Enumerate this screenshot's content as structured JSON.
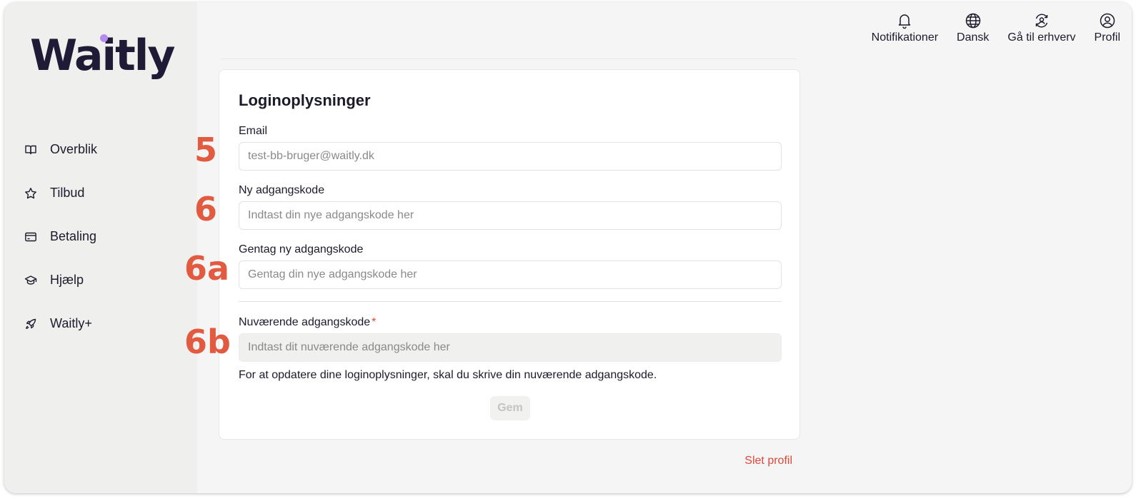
{
  "app": {
    "logo_text": "Waitly",
    "brand_color": "#1f1b36",
    "accent_dot_color": "#b48cf0"
  },
  "sidebar": {
    "items": [
      {
        "label": "Overblik",
        "icon": "book-icon"
      },
      {
        "label": "Tilbud",
        "icon": "star-icon"
      },
      {
        "label": "Betaling",
        "icon": "card-icon"
      },
      {
        "label": "Hjælp",
        "icon": "graduation-cap-icon"
      },
      {
        "label": "Waitly+",
        "icon": "rocket-icon"
      }
    ]
  },
  "topbar": {
    "notifications": "Notifikationer",
    "language": "Dansk",
    "business": "Gå til erhverv",
    "profile": "Profil"
  },
  "card": {
    "title": "Loginoplysninger",
    "email": {
      "label": "Email",
      "value": "test-bb-bruger@waitly.dk"
    },
    "new_password": {
      "label": "Ny adgangskode",
      "placeholder": "Indtast din nye adgangskode her"
    },
    "repeat_password": {
      "label": "Gentag ny adgangskode",
      "placeholder": "Gentag din nye adgangskode her"
    },
    "current_password": {
      "label": "Nuværende adgangskode",
      "required_mark": "*",
      "placeholder": "Indtast dit nuværende adgangskode her"
    },
    "helper_text": "For at opdatere dine loginoplysninger, skal du skrive din nuværende adgangskode.",
    "save_label": "Gem"
  },
  "delete_profile_label": "Slet profil",
  "annotations": {
    "marker_email": "5",
    "marker_new_password": "6",
    "marker_repeat_password": "6a",
    "marker_current_password": "6b",
    "marker_color": "#e25a40"
  }
}
